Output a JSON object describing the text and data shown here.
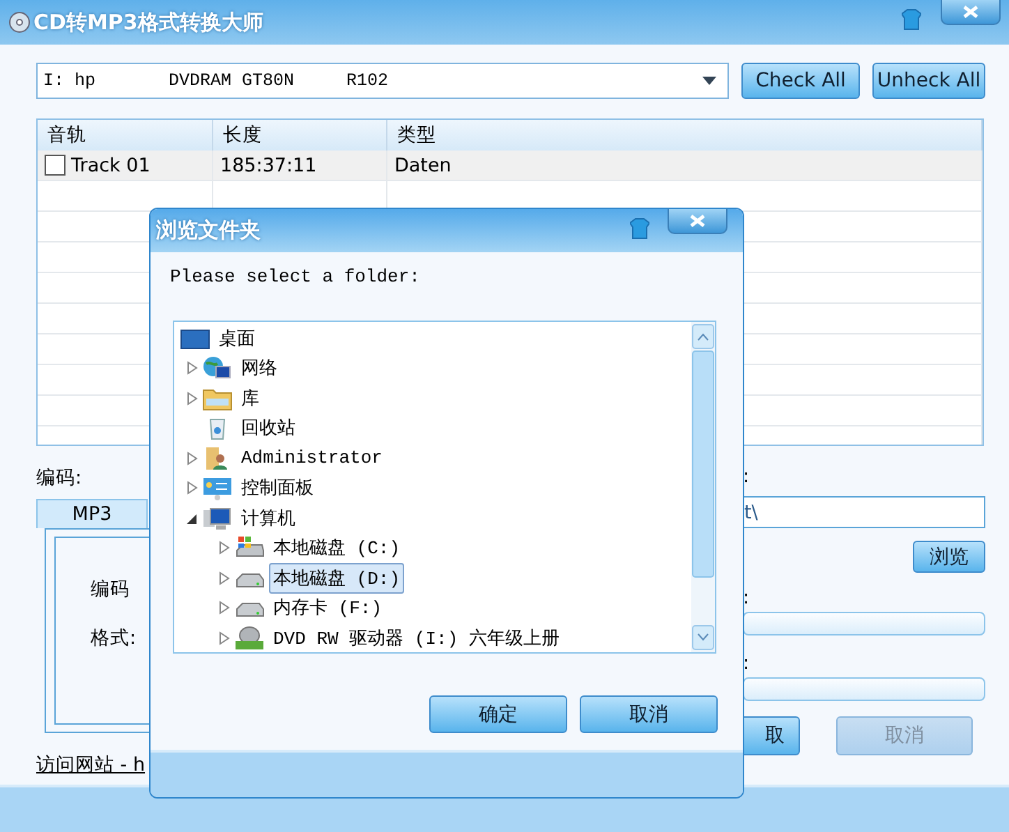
{
  "window": {
    "title": "CD转MP3格式转换大师"
  },
  "drive_select": {
    "value": "I: hp       DVDRAM GT80N     R102"
  },
  "buttons": [
    {
      "label": "Check All"
    },
    {
      "label": "Unheck All"
    }
  ],
  "track_table": {
    "columns": [
      "音轨",
      "长度",
      "类型"
    ],
    "rows": [
      {
        "checked": false,
        "cells": [
          "Track 01",
          "185:37:11",
          "Daten"
        ]
      }
    ]
  },
  "encoder": {
    "label": "编码:",
    "tabs": [
      {
        "label": "MP3",
        "selected": true
      }
    ],
    "fields": [
      "编码",
      "格式:"
    ]
  },
  "output": {
    "label": ":",
    "path": "t\\",
    "browse_button": "浏览",
    "progress": [
      {
        "label": ":",
        "level": 0
      },
      {
        "label": ":",
        "level": 0
      }
    ]
  },
  "actions": [
    {
      "label": "取",
      "disabled": false
    },
    {
      "label": "取消",
      "disabled": true
    }
  ],
  "link": "访问网站 - h",
  "dialog": {
    "title": "浏览文件夹",
    "prompt": "Please select a folder:",
    "tree": [
      {
        "label": "桌面",
        "kind": "desktop",
        "selected": false,
        "children": [
          {
            "label": "网络",
            "kind": "network",
            "expandable": true,
            "expanded": false,
            "selected": false
          },
          {
            "label": "库",
            "kind": "library",
            "expandable": true,
            "expanded": false,
            "selected": false
          },
          {
            "label": "回收站",
            "kind": "recycle-bin",
            "expandable": false,
            "selected": false
          },
          {
            "label": "Administrator",
            "kind": "user-folder",
            "expandable": true,
            "expanded": false,
            "selected": false
          },
          {
            "label": "控制面板",
            "kind": "control-panel",
            "expandable": true,
            "expanded": false,
            "selected": false
          },
          {
            "label": "计算机",
            "kind": "computer",
            "expandable": true,
            "expanded": true,
            "selected": false,
            "children": [
              {
                "label": "本地磁盘 (C:)",
                "kind": "system-drive",
                "expandable": true,
                "expanded": false,
                "selected": false
              },
              {
                "label": "本地磁盘 (D:)",
                "kind": "drive",
                "expandable": true,
                "expanded": false,
                "selected": true
              },
              {
                "label": "内存卡 (F:)",
                "kind": "drive",
                "expandable": true,
                "expanded": false,
                "selected": false
              },
              {
                "label": "DVD RW 驱动器 (I:) 六年级上册",
                "kind": "dvd-drive",
                "expandable": true,
                "expanded": false,
                "selected": false
              }
            ]
          }
        ]
      }
    ],
    "buttons": [
      {
        "label": "确定"
      },
      {
        "label": "取消"
      }
    ]
  }
}
